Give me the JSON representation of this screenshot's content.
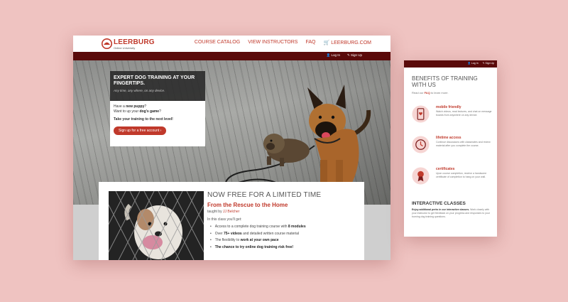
{
  "desktop": {
    "logo": {
      "name": "LEERBURG",
      "tagline": "Online University"
    },
    "nav": [
      "COURSE CATALOG",
      "VIEW INSTRUCTORS",
      "FAQ",
      "LEERBURG.COM"
    ],
    "util": {
      "login": "Log In",
      "signup": "Sign Up"
    },
    "hero": {
      "heading": "EXPERT DOG TRAINING AT YOUR FINGERTIPS.",
      "subheading": "Any time, any where, on any device.",
      "line1_pre": "Have a ",
      "line1_bold": "new puppy",
      "line1_post": "?",
      "line2_pre": "Want to up your ",
      "line2_bold": "dog's game",
      "line2_post": "?",
      "line3": "Take your training to the next level!",
      "cta": "Sign up for a free account ›"
    },
    "promo": {
      "title": "NOW FREE FOR A LIMITED TIME",
      "course_title": "From the Rescue to the Home",
      "taught_by": "taught by ",
      "instructor": "JJ Belcher",
      "class_intro": "In this class you'll get:",
      "features": [
        {
          "pre": "Access to a complete dog training course with ",
          "bold": "8 modules",
          "post": ""
        },
        {
          "pre": "Over ",
          "bold": "75+ videos",
          "post": " and detailed written course material"
        },
        {
          "pre": "The flexibility to ",
          "bold": "work at your own pace",
          "post": ""
        },
        {
          "pre": "",
          "bold": "The chance to try online dog training risk free!",
          "post": ""
        }
      ]
    }
  },
  "mobile": {
    "util": {
      "login": "Log In",
      "signup": "Sign Up"
    },
    "heading": "BENEFITS OF TRAINING WITH US",
    "read_pre": "Read our ",
    "read_link": "FAQ",
    "read_post": " to learn more.",
    "benefits": [
      {
        "title": "mobile friendly",
        "desc": "Watch videos, read lectures, and chat on message boards from anywhere on any device."
      },
      {
        "title": "lifetime access",
        "desc": "Continue discussions with classmates and review material after you complete the course."
      },
      {
        "title": "certificates",
        "desc": "Upon course completion, receive a handsome certificate of completion to hang on your wall."
      }
    ],
    "interactive_title": "INTERACTIVE CLASSES",
    "interactive_bold": "Enjoy additional perks in our interactive classes.",
    "interactive_desc": " Work closely with your instructor to get feedback on your progress and responses to your burning dog training questions."
  },
  "colors": {
    "accent": "#c0392b",
    "dark_bar": "#5a0a0a",
    "background": "#efc3c1"
  }
}
